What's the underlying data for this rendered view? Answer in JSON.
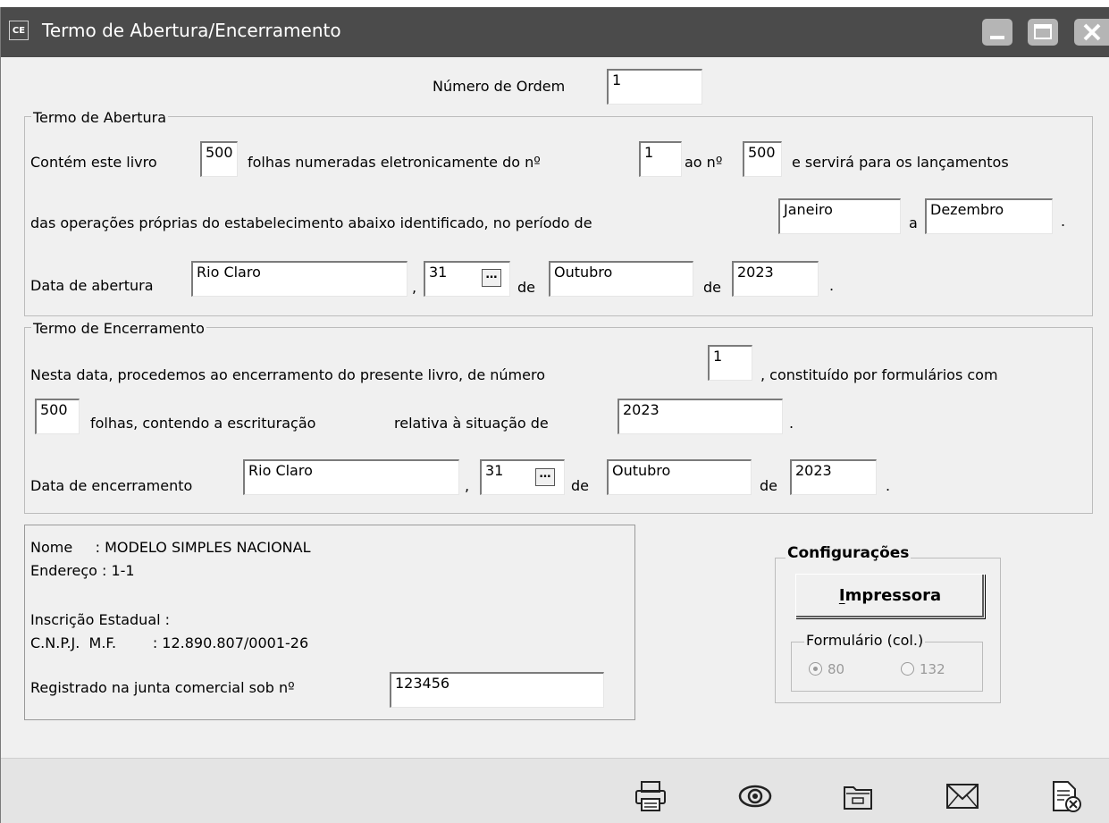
{
  "window": {
    "app_icon_text": "CE",
    "title": "Termo de Abertura/Encerramento"
  },
  "numero_ordem": {
    "label": "Número de Ordem",
    "value": "1"
  },
  "abertura": {
    "legend": "Termo de Abertura",
    "line1_prefix": "Contém este livro",
    "folhas": "500",
    "line1_mid": "folhas numeradas eletronicamente do nº",
    "numero_inicial": "1",
    "line1_ao": "ao nº",
    "numero_final": "500",
    "line1_suffix": "e servirá para os lançamentos",
    "line2_text": "das operações próprias do estabelecimento abaixo identificado, no período de",
    "periodo_inicio": "Janeiro",
    "periodo_a": "a",
    "periodo_fim": "Dezembro",
    "period_dot": ".",
    "data_label": "Data de abertura",
    "cidade": "Rio Claro",
    "comma": ",",
    "dia": "31",
    "de1": "de",
    "mes": "Outubro",
    "de2": "de",
    "ano": "2023",
    "end_dot": "."
  },
  "encerramento": {
    "legend": "Termo de Encerramento",
    "line1_prefix": "Nesta data, procedemos ao encerramento do presente livro, de número",
    "numero_livro": "1",
    "line1_suffix": ", constituído por formulários com",
    "folhas": "500",
    "line2_a": "folhas, contendo a escrituração",
    "line2_b": "relativa à situação de",
    "situacao": "2023",
    "line2_dot": ".",
    "data_label": "Data de encerramento",
    "cidade": "Rio Claro",
    "comma": ",",
    "dia": "31",
    "de1": "de",
    "mes": "Outubro",
    "de2": "de",
    "ano": "2023",
    "end_dot": "."
  },
  "empresa": {
    "nome": "Nome     : MODELO SIMPLES NACIONAL",
    "endereco": "Endereço : 1-1",
    "inscricao": "Inscrição Estadual :",
    "cnpj": "C.N.P.J.  M.F.        : 12.890.807/0001-26",
    "registro_label": "Registrado na junta comercial sob nº",
    "registro": "123456"
  },
  "configuracoes": {
    "legend": "Configurações",
    "printer_button_label": "Impressora",
    "formulario_legend": "Formulário (col.)",
    "options": [
      {
        "label": "80",
        "selected": true
      },
      {
        "label": "132",
        "selected": false
      }
    ]
  },
  "footer_icons": [
    "printer-icon",
    "preview-eye-icon",
    "folder-icon",
    "email-envelope-icon",
    "close-document-icon"
  ]
}
